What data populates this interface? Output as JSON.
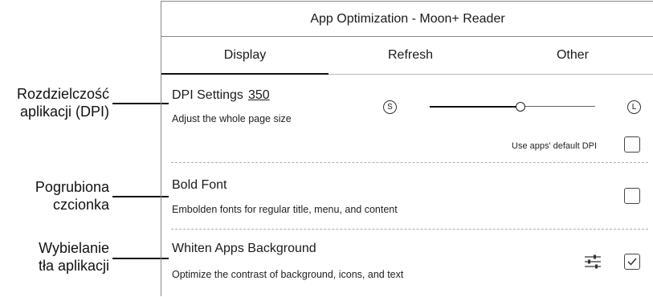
{
  "annotations": [
    {
      "line1": "Rozdzielczość",
      "line2": "aplikacji (DPI)"
    },
    {
      "line1": "Pogrubiona",
      "line2": "czcionka"
    },
    {
      "line1": "Wybielanie",
      "line2": "tła aplikacji"
    }
  ],
  "window": {
    "title": "App Optimization - Moon+ Reader"
  },
  "tabs": [
    {
      "label": "Display",
      "selected": true
    },
    {
      "label": "Refresh",
      "selected": false
    },
    {
      "label": "Other",
      "selected": false
    }
  ],
  "dpi": {
    "title": "DPI Settings",
    "value": "350",
    "subtitle": "Adjust the whole page size",
    "small_label": "S",
    "large_label": "L",
    "slider_fraction": 0.55,
    "default_label": "Use apps' default DPI",
    "default_checked": false
  },
  "bold_font": {
    "title": "Bold Font",
    "subtitle": "Embolden fonts for regular title, menu, and content",
    "checked": false
  },
  "whiten": {
    "title": "Whiten Apps Background",
    "subtitle": "Optimize the contrast of background, icons, and text",
    "settings_icon": "sliders-icon",
    "checked": true
  }
}
